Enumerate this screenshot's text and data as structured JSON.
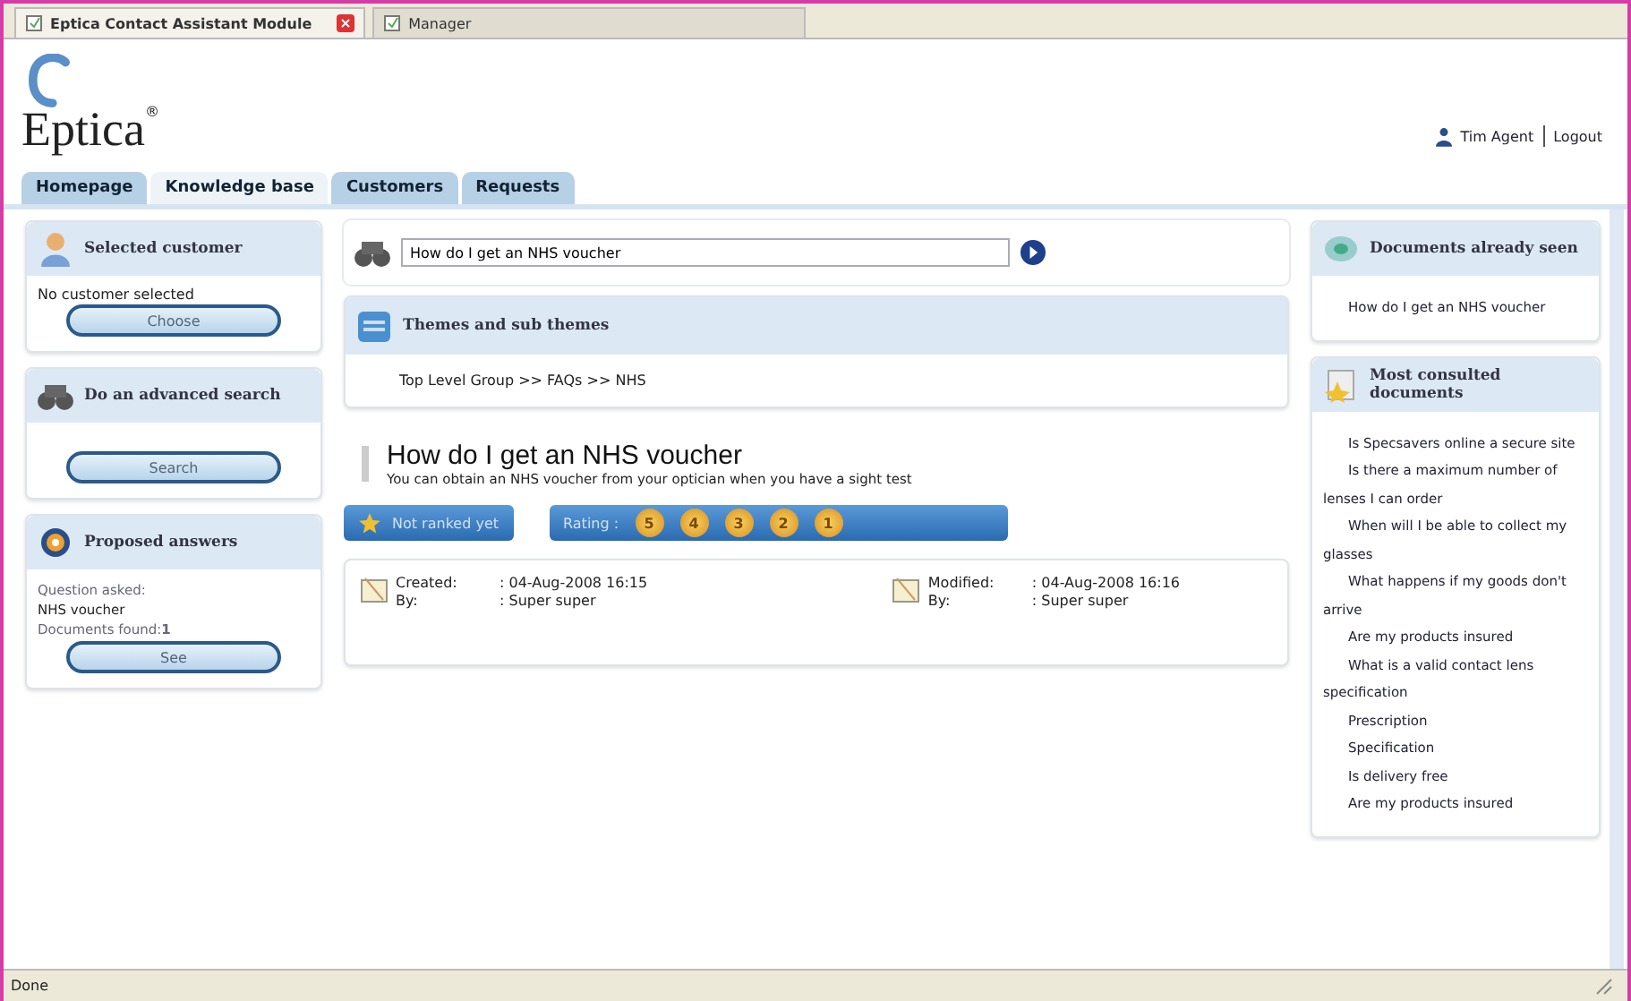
{
  "browser_tabs": [
    {
      "label": "Eptica Contact Assistant Module",
      "selected": true,
      "closable": true
    },
    {
      "label": "Manager",
      "selected": false,
      "closable": false
    }
  ],
  "logo": {
    "text": "Eptica",
    "mark": "®"
  },
  "user": {
    "name": "Tim Agent",
    "logout": "Logout"
  },
  "tabs": [
    {
      "label": "Homepage",
      "selected": false
    },
    {
      "label": "Knowledge base",
      "selected": true
    },
    {
      "label": "Customers",
      "selected": false
    },
    {
      "label": "Requests",
      "selected": false
    }
  ],
  "left_panels": [
    {
      "kind": "customer",
      "title": "Selected customer",
      "text": "No customer selected",
      "button": "Choose"
    },
    {
      "kind": "search",
      "title": "Do an advanced search",
      "button": "Search"
    },
    {
      "kind": "answers",
      "title": "Proposed answers",
      "question_label": "Question asked:",
      "question": "NHS voucher",
      "found_label": "Documents found:",
      "found": "1",
      "button": "See"
    }
  ],
  "search": {
    "value": "How do I get an NHS voucher"
  },
  "themes": {
    "title": "Themes and sub themes",
    "path": "Top Level Group >> FAQs >> NHS"
  },
  "answer": {
    "title": "How do I get an NHS voucher",
    "text": "You can obtain an NHS voucher from your optician when you have a sight test",
    "ranked_button": "Not ranked yet",
    "rating_label": "Rating :",
    "rating_stars": [
      "5",
      "4",
      "3",
      "2",
      "1"
    ]
  },
  "meta": [
    {
      "date_label": "Created:",
      "date": ": 04-Aug-2008 16:15",
      "by_label": "By:",
      "by": ": Super super"
    },
    {
      "date_label": "Modified:",
      "date": ": 04-Aug-2008 16:16",
      "by_label": "By:",
      "by": ": Super super"
    }
  ],
  "seen": {
    "title": "Documents already seen",
    "items": [
      "How do I get an NHS voucher"
    ]
  },
  "consulted": {
    "title": "Most consulted documents",
    "items": [
      "Is Specsavers online a secure site",
      "Is there a maximum number of lenses I can order",
      "When will I be able to collect my glasses",
      "What happens if my goods don't arrive",
      "Are my products insured",
      "What is a valid contact lens specification",
      "Prescription",
      "Specification",
      "Is delivery free",
      "Are my products insured"
    ]
  },
  "status_bar": {
    "text": "Done"
  }
}
